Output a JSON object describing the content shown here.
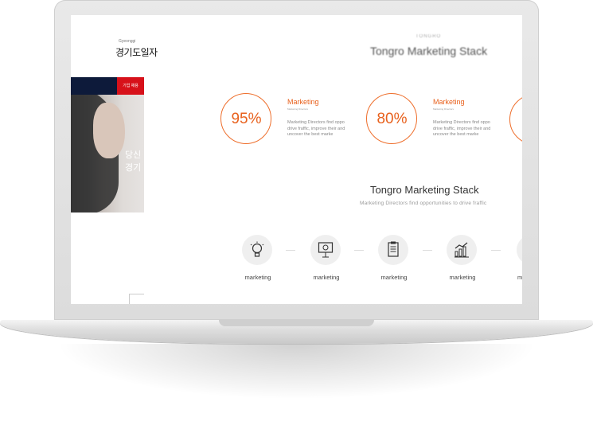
{
  "site": {
    "logo_sub": "Gyeonggi",
    "logo": "경기도일자",
    "nav_red_label": "기업 채용",
    "hero_line1": "당신",
    "hero_line2": "경기"
  },
  "stack_section": {
    "eyebrow": "TONGRO",
    "title_top": "Tongro Marketing Stack",
    "stats": [
      {
        "value": "95%",
        "title": "Marketing",
        "sub": "Marketing Directors",
        "desc": "Marketing Directors find oppo drive fraffic, improve their and uncover the best marke"
      },
      {
        "value": "80%",
        "title": "Marketing",
        "sub": "Marketing Directors",
        "desc": "Marketing Directors find oppo drive fraffic, improve their and uncover the best marke"
      }
    ],
    "title_mid": "Tongro Marketing Stack",
    "subtitle_mid": "Marketing Directors find opportunities to drive fraffic",
    "icons": [
      {
        "icon": "lightbulb-icon",
        "label": "marketing"
      },
      {
        "icon": "presentation-icon",
        "label": "marketing"
      },
      {
        "icon": "document-icon",
        "label": "marketing"
      },
      {
        "icon": "growth-chart-icon",
        "label": "marketing"
      }
    ],
    "edge_label": "m"
  },
  "colors": {
    "accent": "#e8611d",
    "nav_dark": "#0d1a3a",
    "nav_red": "#d7111a"
  }
}
